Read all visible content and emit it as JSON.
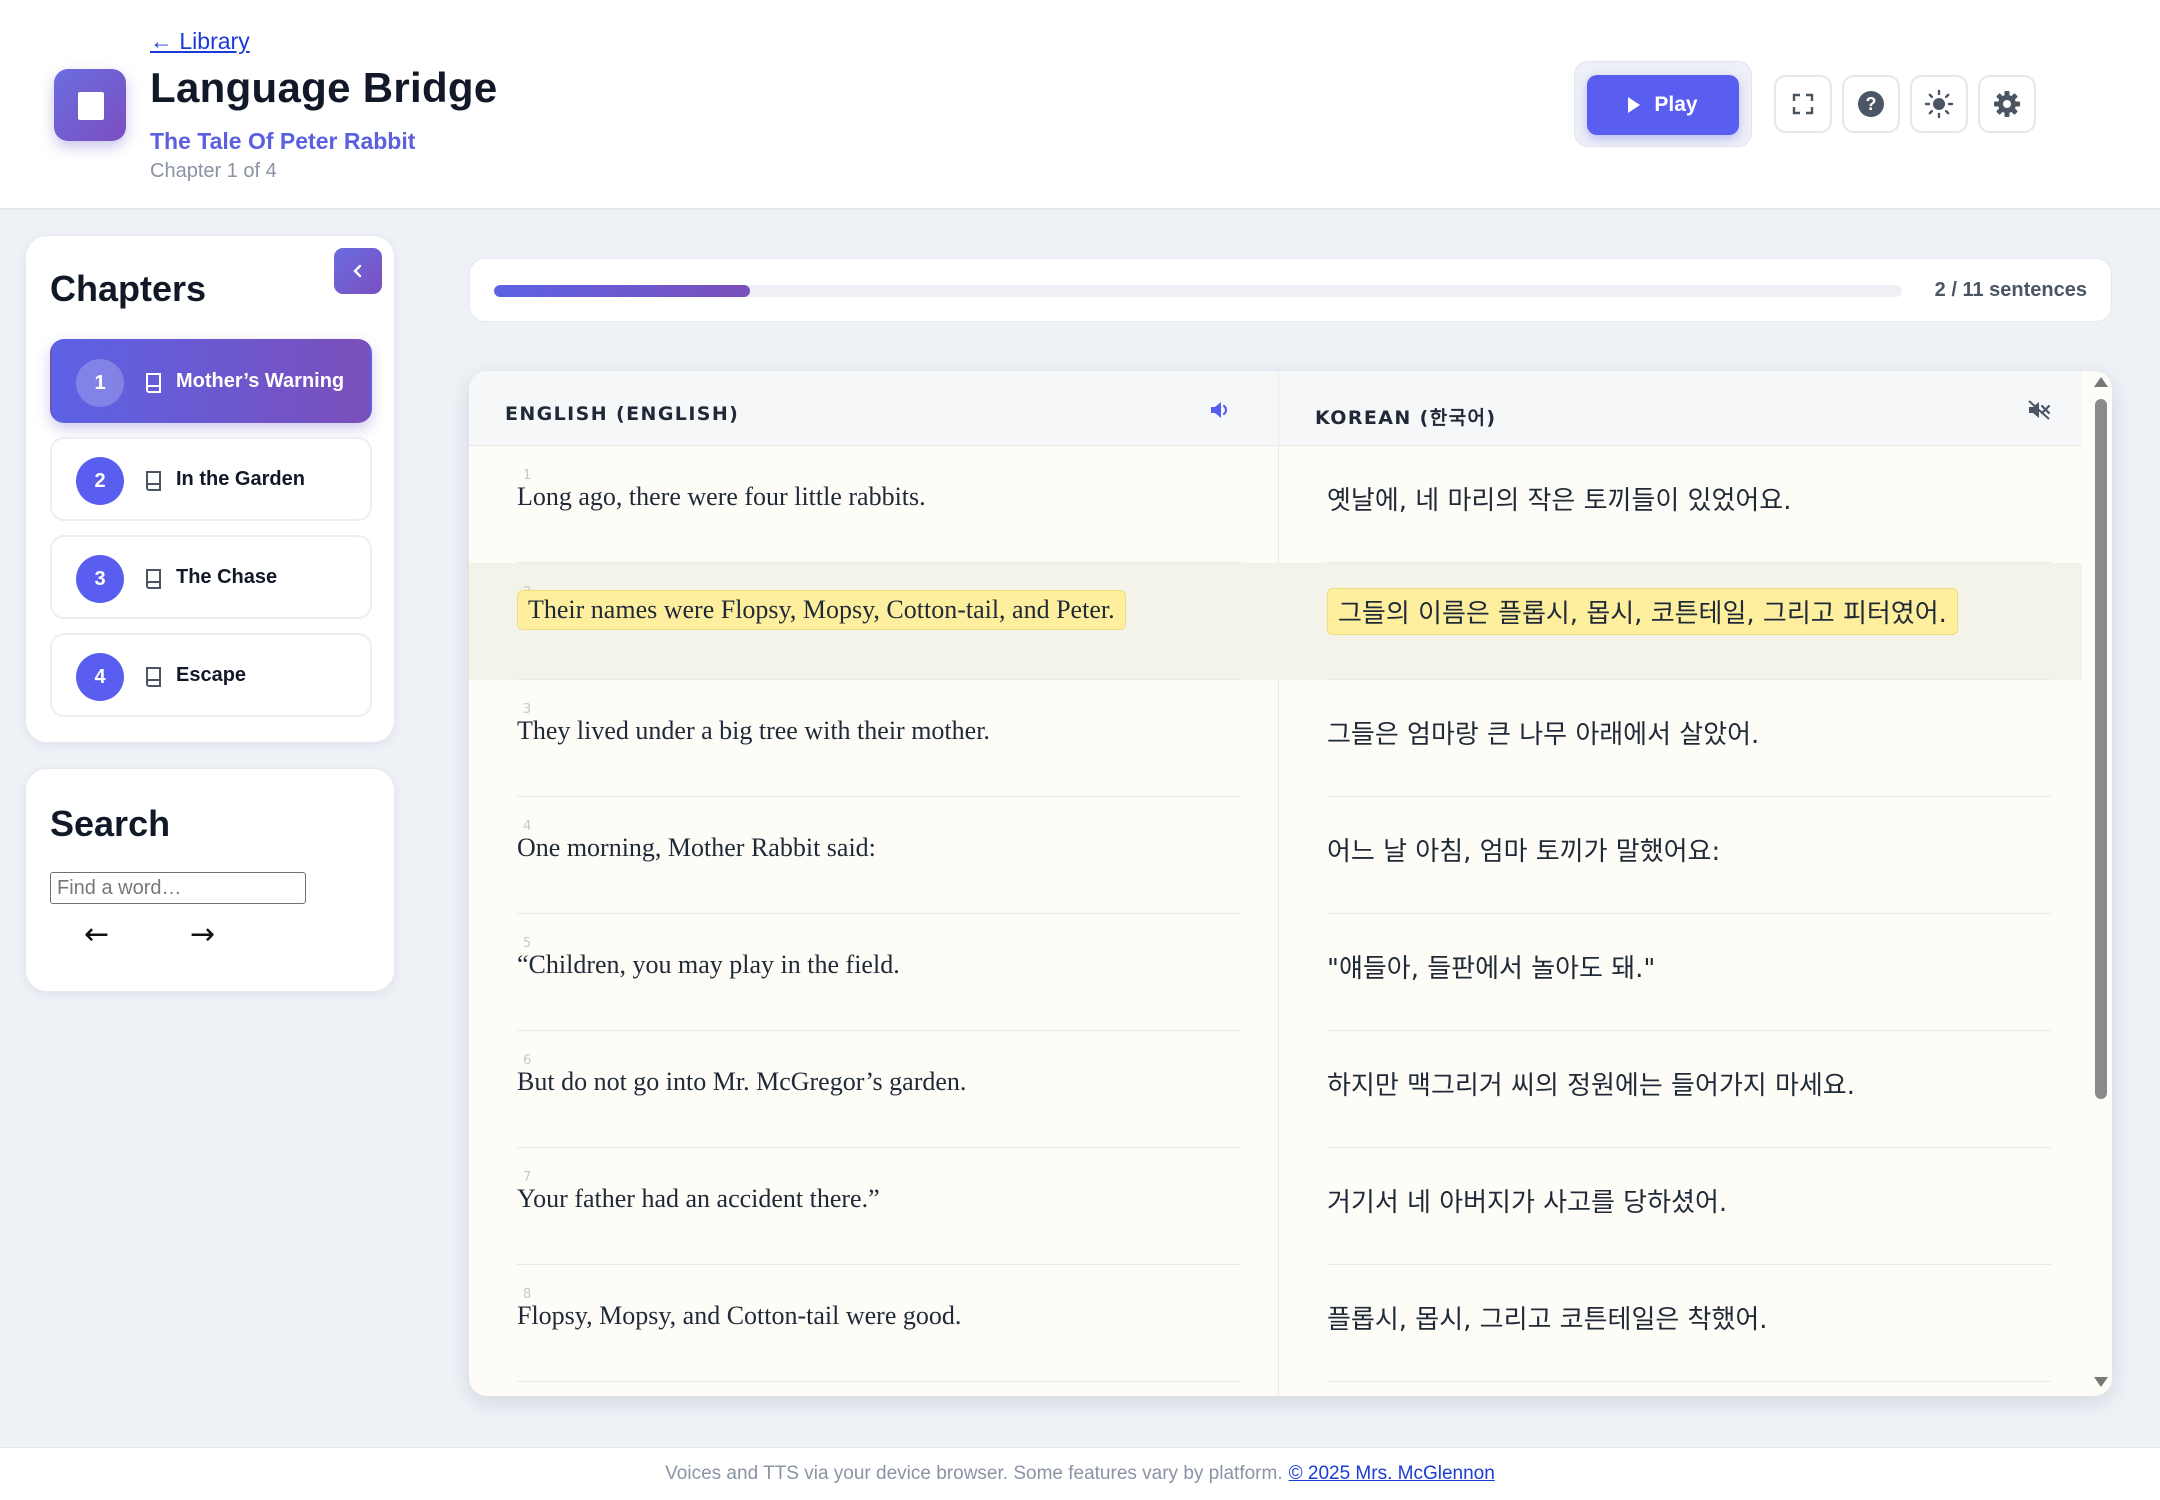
{
  "header": {
    "back_label": "← Library",
    "app_title": "Language Bridge",
    "book_title": "The Tale Of Peter Rabbit",
    "chapter_count": "Chapter 1 of 4",
    "play_label": "Play",
    "icons": [
      "fullscreen-icon",
      "help-icon",
      "sun-icon",
      "gear-icon"
    ]
  },
  "sidebar": {
    "chapters_title": "Chapters",
    "chapters": [
      {
        "number": "1",
        "label": "Mother’s Warning",
        "active": true
      },
      {
        "number": "2",
        "label": "In the Garden",
        "active": false
      },
      {
        "number": "3",
        "label": "The Chase",
        "active": false
      },
      {
        "number": "4",
        "label": "Escape",
        "active": false
      }
    ],
    "search_title": "Search",
    "search_placeholder": "Find a word…",
    "prev_label": "←",
    "next_label": "→"
  },
  "progress": {
    "text": "2 / 11 sentences",
    "current": 2,
    "total": 11,
    "fraction": 0.182
  },
  "reader": {
    "left_header": "ENGLISH (ENGLISH)",
    "right_header": "KOREAN (한국어)",
    "highlight_color": "#fdef9e",
    "rows": [
      {
        "num": "1",
        "en": "Long ago, there were four little rabbits.",
        "ko": "옛날에, 네 마리의 작은 토끼들이 있었어요."
      },
      {
        "num": "2",
        "en": "Their names were Flopsy, Mopsy, Cotton-tail, and Peter.",
        "ko": "그들의 이름은 플롭시, 몹시, 코튼테일, 그리고 피터였어."
      },
      {
        "num": "3",
        "en": "They lived under a big tree with their mother.",
        "ko": "그들은 엄마랑 큰 나무 아래에서 살았어."
      },
      {
        "num": "4",
        "en": "One morning, Mother Rabbit said:",
        "ko": "어느 날 아침, 엄마 토끼가 말했어요:"
      },
      {
        "num": "5",
        "en": "“Children, you may play in the field.",
        "ko": "\"얘들아, 들판에서 놀아도 돼.\""
      },
      {
        "num": "6",
        "en": "But do not go into Mr. McGregor’s garden.",
        "ko": "하지만 맥그리거 씨의 정원에는 들어가지 마세요."
      },
      {
        "num": "7",
        "en": "Your father had an accident there.”",
        "ko": "거기서 네 아버지가 사고를 당하셨어."
      },
      {
        "num": "8",
        "en": "Flopsy, Mopsy, and Cotton-tail were good.",
        "ko": "플롭시, 몹시, 그리고 코튼테일은 착했어."
      }
    ]
  },
  "footer": {
    "text": "Voices and TTS via your device browser. Some features vary by platform.",
    "link": "© 2025 Mrs. McGlennon"
  },
  "colors": {
    "accent": "#5a5ef0",
    "accent_purple": "#7a4fba",
    "highlight": "#fdef9e"
  }
}
